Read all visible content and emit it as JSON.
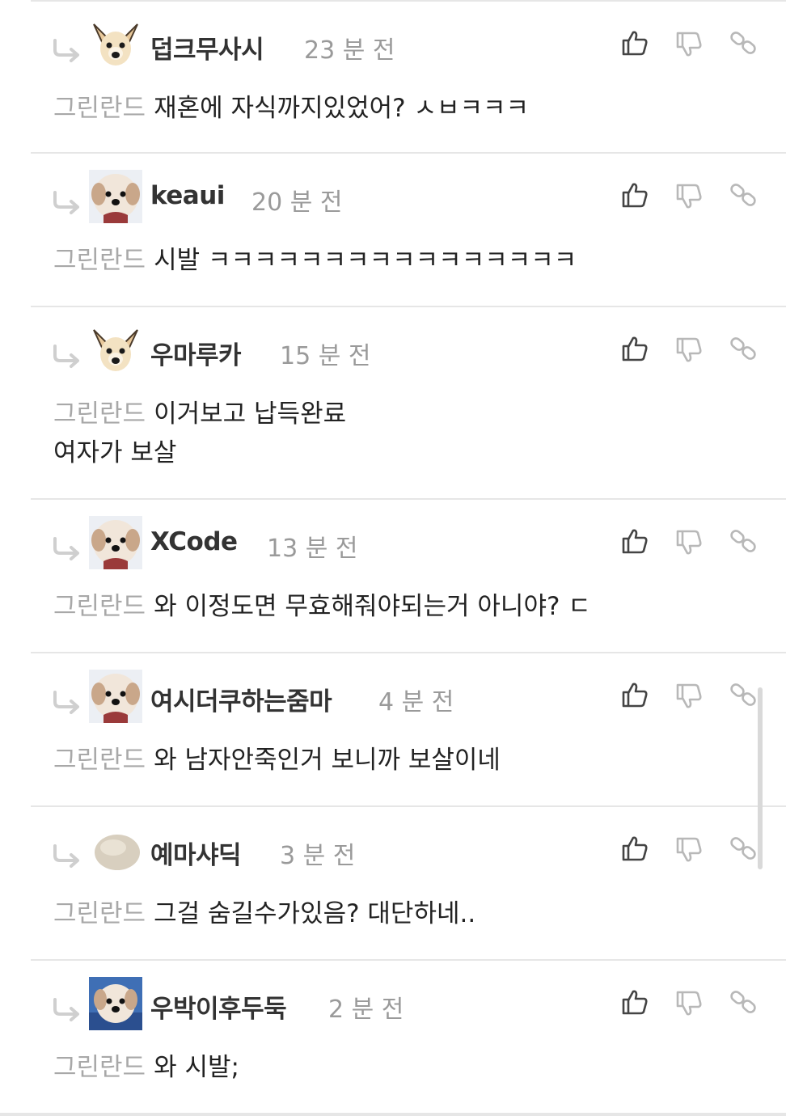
{
  "comments": [
    {
      "username": "덥크무사시",
      "time": "23 분 전",
      "mention": "그린란드",
      "lines": [
        "재혼에 자식까지있었어? ㅅㅂㅋㅋㅋ"
      ],
      "avatar": "chihuahua-avatar"
    },
    {
      "username": "keaui",
      "time": "20 분 전",
      "mention": "그린란드",
      "lines": [
        "시발 ㅋㅋㅋㅋㅋㅋㅋㅋㅋㅋㅋㅋㅋㅋㅋㅋ"
      ],
      "avatar": "puppy-avatar"
    },
    {
      "username": "우마루카",
      "time": "15 분 전",
      "mention": "그린란드",
      "lines": [
        "이거보고 납득완료",
        "여자가 보살"
      ],
      "avatar": "chihuahua-avatar"
    },
    {
      "username": "XCode",
      "time": "13 분 전",
      "mention": "그린란드",
      "lines": [
        "와 이정도면 무효해줘야되는거 아니야? ㄷ"
      ],
      "avatar": "puppy-avatar"
    },
    {
      "username": "여시더쿠하는줌마",
      "time": "4 분 전",
      "mention": "그린란드",
      "lines": [
        "와 남자안죽인거 보니까 보살이네"
      ],
      "avatar": "puppy-avatar"
    },
    {
      "username": "예마샤딕",
      "time": "3 분 전",
      "mention": "그린란드",
      "lines": [
        "그걸 숨길수가있음? 대단하네.."
      ],
      "avatar": "blob-avatar"
    },
    {
      "username": "우박이후두둑",
      "time": "2 분 전",
      "mention": "그린란드",
      "lines": [
        "와 시발;"
      ],
      "avatar": "puppy-blue-avatar"
    }
  ],
  "icons": {
    "like": "thumbs-up-icon",
    "dislike": "thumbs-down-icon",
    "link": "link-icon",
    "reply": "reply-arrow-icon"
  },
  "colors": {
    "username": "#333333",
    "timestamp": "#9a9a9a",
    "mention": "#a8a8a8",
    "divider": "#e6e6e6",
    "icon_active": "#555555",
    "icon_muted": "#b8b8b8"
  }
}
